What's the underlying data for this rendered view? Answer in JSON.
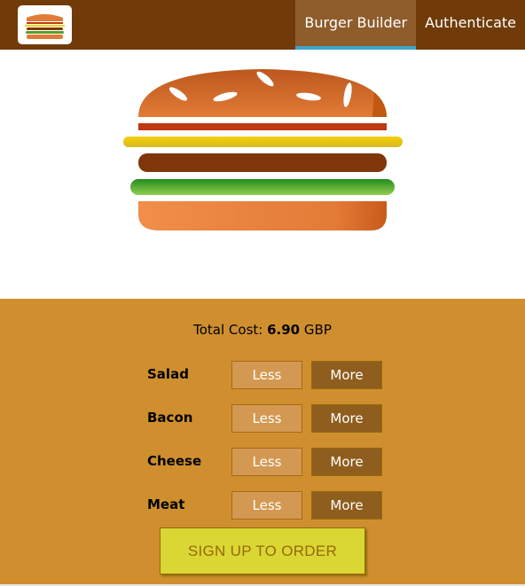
{
  "header": {
    "logo_icon": "burger-logo-icon",
    "nav": [
      {
        "label": "Burger Builder",
        "active": true
      },
      {
        "label": "Authenticate",
        "active": false
      }
    ]
  },
  "burger": {
    "layers": [
      "bread-top",
      "bacon",
      "cheese",
      "meat",
      "salad",
      "bread-bottom"
    ]
  },
  "controls": {
    "total_label": "Total Cost:",
    "total_value": "6.90",
    "currency": "GBP",
    "ingredients": [
      {
        "label": "Salad",
        "less": "Less",
        "more": "More"
      },
      {
        "label": "Bacon",
        "less": "Less",
        "more": "More"
      },
      {
        "label": "Cheese",
        "less": "Less",
        "more": "More"
      },
      {
        "label": "Meat",
        "less": "Less",
        "more": "More"
      }
    ],
    "order_button": "SIGN UP TO ORDER"
  },
  "colors": {
    "toolbar": "#703b09",
    "controls_bg": "#cf8f2e",
    "less_button": "#d39952",
    "more_button": "#8f5e1e",
    "order_button": "#dad735",
    "active_indicator": "#40a4c8"
  }
}
